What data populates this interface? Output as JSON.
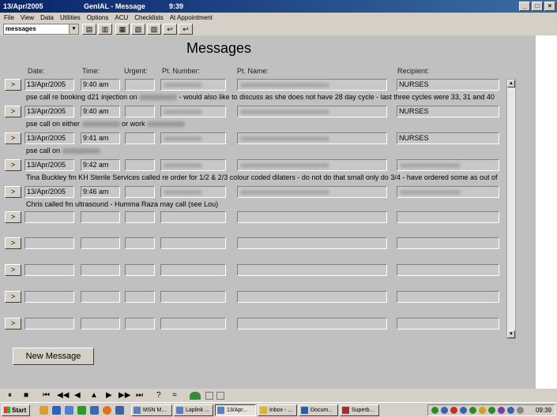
{
  "window": {
    "date": "13/Apr/2005",
    "title": "GenIAL - Message",
    "time": "9:39",
    "btn_min": "_",
    "btn_max": "□",
    "btn_close": "×"
  },
  "menu": [
    "File",
    "View",
    "Data",
    "Utilities",
    "Options",
    "ACU",
    "Checklists",
    "At Appointment"
  ],
  "toolbar": {
    "combo_value": "messages",
    "combo_arrow": "▾",
    "icons": [
      "▤",
      "▥",
      "▦",
      "▧",
      "▨",
      "↩"
    ]
  },
  "page": {
    "title": "Messages"
  },
  "headers": {
    "date": "Date:",
    "time": "Time:",
    "urgent": "Urgent:",
    "pt_number": "Pt. Number:",
    "pt_name": "Pt. Name:",
    "recipient": "Recipient:"
  },
  "row_button_label": ">",
  "rows": [
    {
      "date": "13/Apr/2005",
      "time": "9:40 am",
      "recipient": "NURSES",
      "recipient_visible": true,
      "note_a": "pse call re booking d21 injection on",
      "note_b": "- would also like to discuss as she does not have 28 day cycle - last three cycles were 33, 31 and 40"
    },
    {
      "date": "13/Apr/2005",
      "time": "9:40 am",
      "recipient": "NURSES",
      "recipient_visible": true,
      "note_a": "pse call on either",
      "note_b": "or work"
    },
    {
      "date": "13/Apr/2005",
      "time": "9:41 am",
      "recipient": "NURSES",
      "recipient_visible": true,
      "note_a": "pse call on",
      "note_b": ""
    },
    {
      "date": "13/Apr/2005",
      "time": "9:42 am",
      "recipient": "",
      "recipient_visible": false,
      "note_a": "Tina Buckley fm KH Sterile Services called re order for 1/2 & 2/3 colour coded dilaters - do not do that small only do 3/4 - have ordered some as out of",
      "note_b": ""
    },
    {
      "date": "13/Apr/2005",
      "time": "9:46 am",
      "recipient": "",
      "recipient_visible": false,
      "note_a": "Chris called fm ultrasound - Humma Raza may call (see Lou)",
      "note_b": ""
    }
  ],
  "empty_rows": 5,
  "scroll": {
    "up": "▲",
    "down": "▼"
  },
  "new_message_label": "New Message",
  "nav": {
    "pause": "⏸",
    "stop": "■",
    "first": "⏮",
    "rewind": "◀◀",
    "prev": "◀",
    "up": "▲",
    "next": "▶",
    "forward": "▶▶",
    "last": "⏭",
    "help": "?",
    "equals": "="
  },
  "taskbar": {
    "start": "Start",
    "tasks": [
      "MSN M...",
      "Laplink ...",
      "13/Apr...",
      "Inbox - ...",
      "Docum...",
      "Superb..."
    ],
    "active_task": 2,
    "clock": "09:39"
  }
}
